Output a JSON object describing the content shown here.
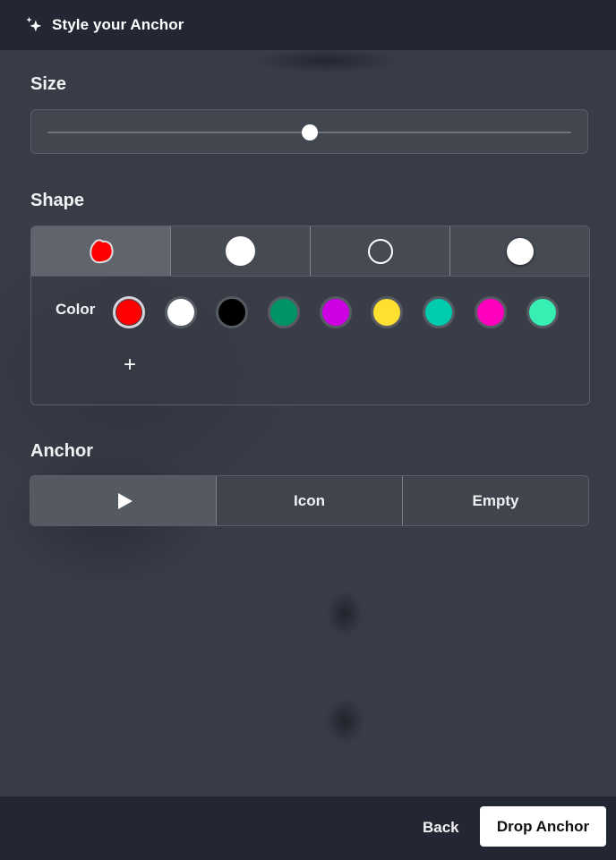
{
  "header": {
    "title": "Style your Anchor",
    "icon": "sparkle-icon"
  },
  "size": {
    "label": "Size",
    "value_percent": 50
  },
  "shape": {
    "label": "Shape",
    "options": [
      {
        "name": "blob",
        "selected": true
      },
      {
        "name": "filled-circle",
        "selected": false
      },
      {
        "name": "ring",
        "selected": false
      },
      {
        "name": "shadow-circle",
        "selected": false
      }
    ],
    "color_label": "Color",
    "colors": [
      "#ff0000",
      "#ffffff",
      "#000000",
      "#009365",
      "#cc00e0",
      "#ffe031",
      "#00cbad",
      "#ff00bf",
      "#38efb3"
    ],
    "selected_color": "#ff0000",
    "add_color_label": "+"
  },
  "anchor": {
    "label": "Anchor",
    "options": [
      {
        "label": "",
        "icon": "play-icon",
        "selected": true
      },
      {
        "label": "Icon",
        "selected": false
      },
      {
        "label": "Empty",
        "selected": false
      }
    ]
  },
  "footer": {
    "back_label": "Back",
    "drop_label": "Drop Anchor"
  }
}
